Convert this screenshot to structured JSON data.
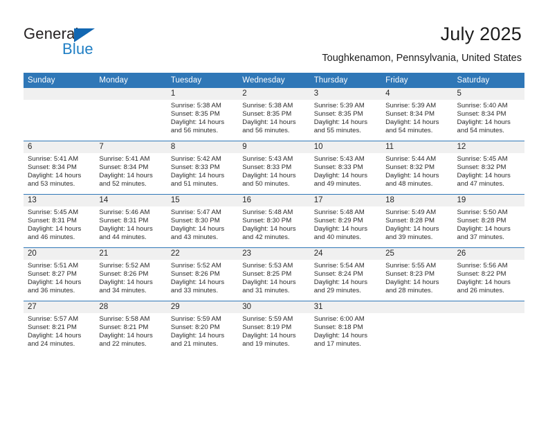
{
  "brand": {
    "name_top": "General",
    "name_bottom": "Blue",
    "accent_color": "#1f7ec4",
    "triangle_color": "#1267b2"
  },
  "header": {
    "title": "July 2025",
    "location": "Toughkenamon, Pennsylvania, United States"
  },
  "theme": {
    "header_row_bg": "#2f77b7",
    "daynum_bg": "#f0f0f0",
    "grid_line": "#2f77b7",
    "text": "#202020"
  },
  "weekday_headers": [
    "Sunday",
    "Monday",
    "Tuesday",
    "Wednesday",
    "Thursday",
    "Friday",
    "Saturday"
  ],
  "weeks": [
    [
      {
        "day": "",
        "empty": true,
        "sunrise": "",
        "sunset": "",
        "daylight_line1": "",
        "daylight_line2": ""
      },
      {
        "day": "",
        "empty": true,
        "sunrise": "",
        "sunset": "",
        "daylight_line1": "",
        "daylight_line2": ""
      },
      {
        "day": "1",
        "sunrise": "Sunrise: 5:38 AM",
        "sunset": "Sunset: 8:35 PM",
        "daylight_line1": "Daylight: 14 hours",
        "daylight_line2": "and 56 minutes."
      },
      {
        "day": "2",
        "sunrise": "Sunrise: 5:38 AM",
        "sunset": "Sunset: 8:35 PM",
        "daylight_line1": "Daylight: 14 hours",
        "daylight_line2": "and 56 minutes."
      },
      {
        "day": "3",
        "sunrise": "Sunrise: 5:39 AM",
        "sunset": "Sunset: 8:35 PM",
        "daylight_line1": "Daylight: 14 hours",
        "daylight_line2": "and 55 minutes."
      },
      {
        "day": "4",
        "sunrise": "Sunrise: 5:39 AM",
        "sunset": "Sunset: 8:34 PM",
        "daylight_line1": "Daylight: 14 hours",
        "daylight_line2": "and 54 minutes."
      },
      {
        "day": "5",
        "sunrise": "Sunrise: 5:40 AM",
        "sunset": "Sunset: 8:34 PM",
        "daylight_line1": "Daylight: 14 hours",
        "daylight_line2": "and 54 minutes."
      }
    ],
    [
      {
        "day": "6",
        "sunrise": "Sunrise: 5:41 AM",
        "sunset": "Sunset: 8:34 PM",
        "daylight_line1": "Daylight: 14 hours",
        "daylight_line2": "and 53 minutes."
      },
      {
        "day": "7",
        "sunrise": "Sunrise: 5:41 AM",
        "sunset": "Sunset: 8:34 PM",
        "daylight_line1": "Daylight: 14 hours",
        "daylight_line2": "and 52 minutes."
      },
      {
        "day": "8",
        "sunrise": "Sunrise: 5:42 AM",
        "sunset": "Sunset: 8:33 PM",
        "daylight_line1": "Daylight: 14 hours",
        "daylight_line2": "and 51 minutes."
      },
      {
        "day": "9",
        "sunrise": "Sunrise: 5:43 AM",
        "sunset": "Sunset: 8:33 PM",
        "daylight_line1": "Daylight: 14 hours",
        "daylight_line2": "and 50 minutes."
      },
      {
        "day": "10",
        "sunrise": "Sunrise: 5:43 AM",
        "sunset": "Sunset: 8:33 PM",
        "daylight_line1": "Daylight: 14 hours",
        "daylight_line2": "and 49 minutes."
      },
      {
        "day": "11",
        "sunrise": "Sunrise: 5:44 AM",
        "sunset": "Sunset: 8:32 PM",
        "daylight_line1": "Daylight: 14 hours",
        "daylight_line2": "and 48 minutes."
      },
      {
        "day": "12",
        "sunrise": "Sunrise: 5:45 AM",
        "sunset": "Sunset: 8:32 PM",
        "daylight_line1": "Daylight: 14 hours",
        "daylight_line2": "and 47 minutes."
      }
    ],
    [
      {
        "day": "13",
        "sunrise": "Sunrise: 5:45 AM",
        "sunset": "Sunset: 8:31 PM",
        "daylight_line1": "Daylight: 14 hours",
        "daylight_line2": "and 46 minutes."
      },
      {
        "day": "14",
        "sunrise": "Sunrise: 5:46 AM",
        "sunset": "Sunset: 8:31 PM",
        "daylight_line1": "Daylight: 14 hours",
        "daylight_line2": "and 44 minutes."
      },
      {
        "day": "15",
        "sunrise": "Sunrise: 5:47 AM",
        "sunset": "Sunset: 8:30 PM",
        "daylight_line1": "Daylight: 14 hours",
        "daylight_line2": "and 43 minutes."
      },
      {
        "day": "16",
        "sunrise": "Sunrise: 5:48 AM",
        "sunset": "Sunset: 8:30 PM",
        "daylight_line1": "Daylight: 14 hours",
        "daylight_line2": "and 42 minutes."
      },
      {
        "day": "17",
        "sunrise": "Sunrise: 5:48 AM",
        "sunset": "Sunset: 8:29 PM",
        "daylight_line1": "Daylight: 14 hours",
        "daylight_line2": "and 40 minutes."
      },
      {
        "day": "18",
        "sunrise": "Sunrise: 5:49 AM",
        "sunset": "Sunset: 8:28 PM",
        "daylight_line1": "Daylight: 14 hours",
        "daylight_line2": "and 39 minutes."
      },
      {
        "day": "19",
        "sunrise": "Sunrise: 5:50 AM",
        "sunset": "Sunset: 8:28 PM",
        "daylight_line1": "Daylight: 14 hours",
        "daylight_line2": "and 37 minutes."
      }
    ],
    [
      {
        "day": "20",
        "sunrise": "Sunrise: 5:51 AM",
        "sunset": "Sunset: 8:27 PM",
        "daylight_line1": "Daylight: 14 hours",
        "daylight_line2": "and 36 minutes."
      },
      {
        "day": "21",
        "sunrise": "Sunrise: 5:52 AM",
        "sunset": "Sunset: 8:26 PM",
        "daylight_line1": "Daylight: 14 hours",
        "daylight_line2": "and 34 minutes."
      },
      {
        "day": "22",
        "sunrise": "Sunrise: 5:52 AM",
        "sunset": "Sunset: 8:26 PM",
        "daylight_line1": "Daylight: 14 hours",
        "daylight_line2": "and 33 minutes."
      },
      {
        "day": "23",
        "sunrise": "Sunrise: 5:53 AM",
        "sunset": "Sunset: 8:25 PM",
        "daylight_line1": "Daylight: 14 hours",
        "daylight_line2": "and 31 minutes."
      },
      {
        "day": "24",
        "sunrise": "Sunrise: 5:54 AM",
        "sunset": "Sunset: 8:24 PM",
        "daylight_line1": "Daylight: 14 hours",
        "daylight_line2": "and 29 minutes."
      },
      {
        "day": "25",
        "sunrise": "Sunrise: 5:55 AM",
        "sunset": "Sunset: 8:23 PM",
        "daylight_line1": "Daylight: 14 hours",
        "daylight_line2": "and 28 minutes."
      },
      {
        "day": "26",
        "sunrise": "Sunrise: 5:56 AM",
        "sunset": "Sunset: 8:22 PM",
        "daylight_line1": "Daylight: 14 hours",
        "daylight_line2": "and 26 minutes."
      }
    ],
    [
      {
        "day": "27",
        "sunrise": "Sunrise: 5:57 AM",
        "sunset": "Sunset: 8:21 PM",
        "daylight_line1": "Daylight: 14 hours",
        "daylight_line2": "and 24 minutes."
      },
      {
        "day": "28",
        "sunrise": "Sunrise: 5:58 AM",
        "sunset": "Sunset: 8:21 PM",
        "daylight_line1": "Daylight: 14 hours",
        "daylight_line2": "and 22 minutes."
      },
      {
        "day": "29",
        "sunrise": "Sunrise: 5:59 AM",
        "sunset": "Sunset: 8:20 PM",
        "daylight_line1": "Daylight: 14 hours",
        "daylight_line2": "and 21 minutes."
      },
      {
        "day": "30",
        "sunrise": "Sunrise: 5:59 AM",
        "sunset": "Sunset: 8:19 PM",
        "daylight_line1": "Daylight: 14 hours",
        "daylight_line2": "and 19 minutes."
      },
      {
        "day": "31",
        "sunrise": "Sunrise: 6:00 AM",
        "sunset": "Sunset: 8:18 PM",
        "daylight_line1": "Daylight: 14 hours",
        "daylight_line2": "and 17 minutes."
      },
      {
        "day": "",
        "empty": true,
        "sunrise": "",
        "sunset": "",
        "daylight_line1": "",
        "daylight_line2": ""
      },
      {
        "day": "",
        "empty": true,
        "sunrise": "",
        "sunset": "",
        "daylight_line1": "",
        "daylight_line2": ""
      }
    ]
  ]
}
